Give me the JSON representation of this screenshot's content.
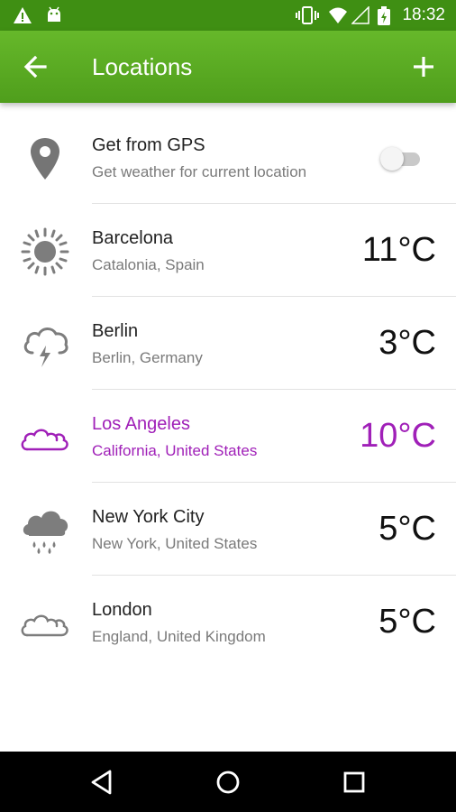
{
  "status_bar": {
    "time": "18:32",
    "icons": [
      "warning-icon",
      "android-icon",
      "vibrate-icon",
      "wifi-icon",
      "signal-icon",
      "battery-charging-icon"
    ]
  },
  "app_bar": {
    "title": "Locations",
    "back_icon": "arrow-left-icon",
    "add_icon": "plus-icon"
  },
  "gps": {
    "title": "Get from GPS",
    "subtitle": "Get weather for current location",
    "enabled": false
  },
  "locations": [
    {
      "name": "Barcelona",
      "region": "Catalonia, Spain",
      "temp": "11°C",
      "icon": "sunny-icon",
      "highlight": false
    },
    {
      "name": "Berlin",
      "region": "Berlin, Germany",
      "temp": "3°C",
      "icon": "thunderstorm-icon",
      "highlight": false
    },
    {
      "name": "Los Angeles",
      "region": "California, United States",
      "temp": "10°C",
      "icon": "cloudy-icon",
      "highlight": true
    },
    {
      "name": "New York City",
      "region": "New York, United States",
      "temp": "5°C",
      "icon": "rain-icon",
      "highlight": false
    },
    {
      "name": "London",
      "region": "England, United Kingdom",
      "temp": "5°C",
      "icon": "cloudy-icon",
      "highlight": false
    }
  ],
  "colors": {
    "app_bar": "#5aad22",
    "status_bar": "#3f8f13",
    "highlight": "#a020b8"
  },
  "nav_bar": [
    "back-triangle-icon",
    "home-circle-icon",
    "recents-square-icon"
  ]
}
